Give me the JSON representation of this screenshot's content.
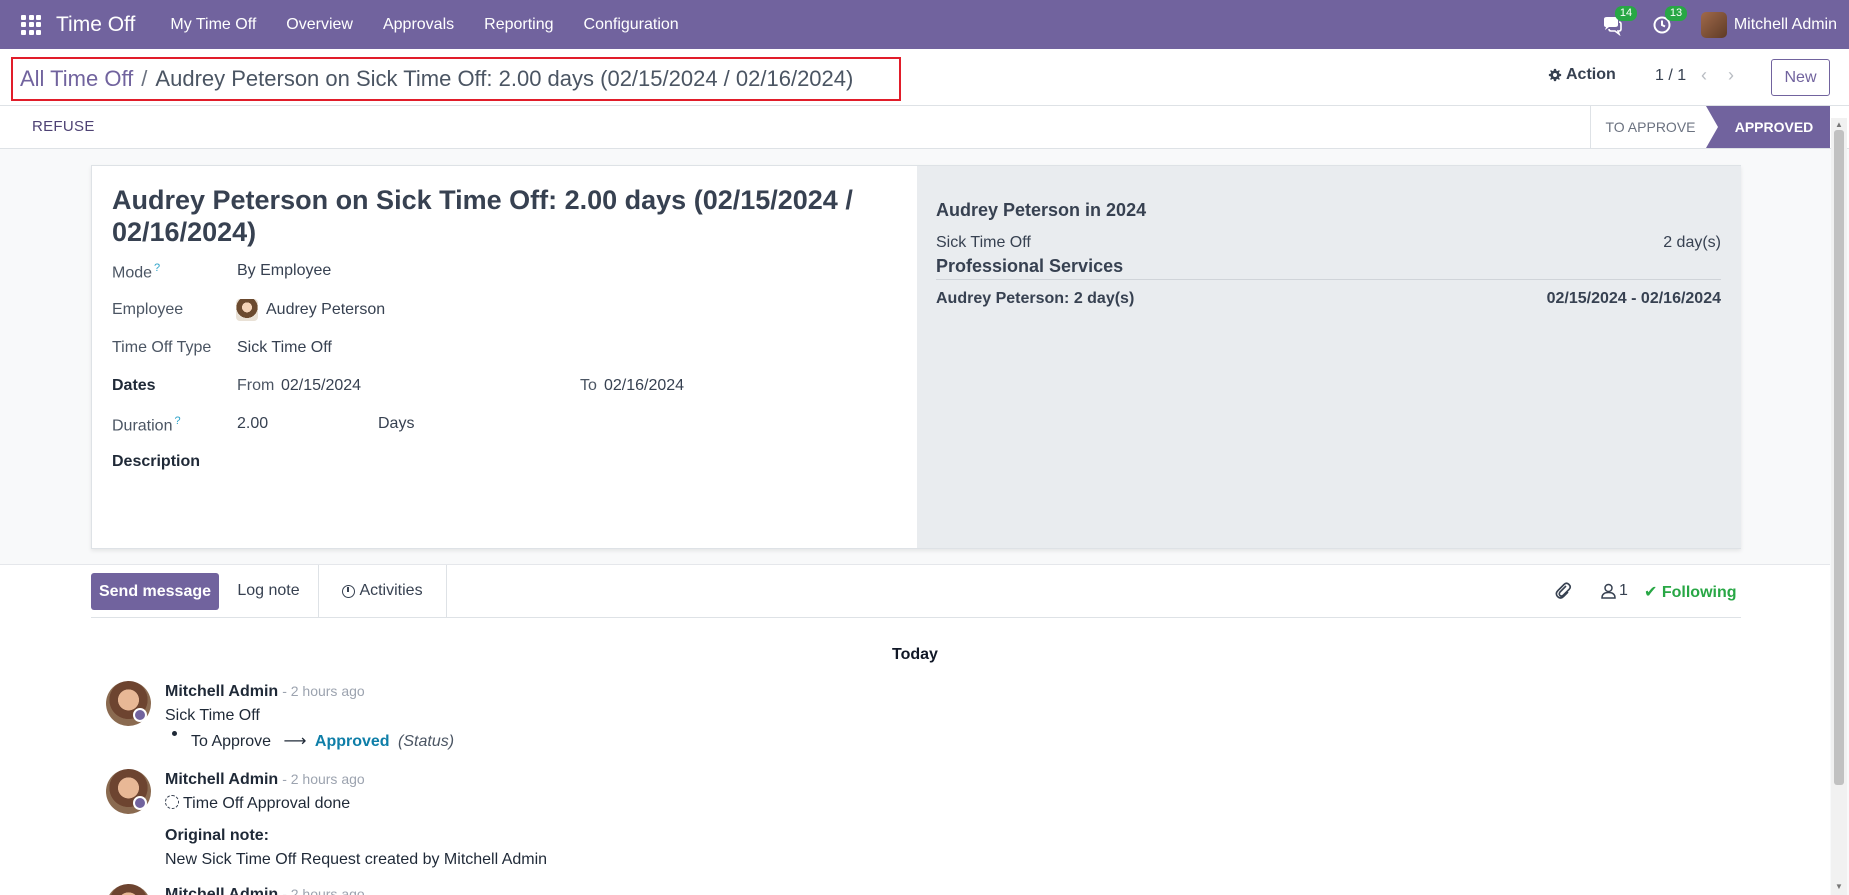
{
  "navbar": {
    "app_name": "Time Off",
    "menu": [
      "My Time Off",
      "Overview",
      "Approvals",
      "Reporting",
      "Configuration"
    ],
    "messages_count": "14",
    "activities_count": "13",
    "user_name": "Mitchell Admin",
    "accent_color": "#71639e"
  },
  "breadcrumb": {
    "parent": "All Time Off",
    "separator": "/",
    "current": "Audrey Peterson on Sick Time Off: 2.00 days (02/15/2024 / 02/16/2024)"
  },
  "control": {
    "action_label": "Action",
    "pager": "1 / 1",
    "new_label": "New"
  },
  "statusbar": {
    "refuse_label": "REFUSE",
    "stages": [
      "TO APPROVE",
      "APPROVED"
    ],
    "active_stage": "APPROVED"
  },
  "form": {
    "title": "Audrey Peterson on Sick Time Off: 2.00 days (02/15/2024 / 02/16/2024)",
    "mode_label": "Mode",
    "mode_value": "By Employee",
    "employee_label": "Employee",
    "employee_value": "Audrey Peterson",
    "type_label": "Time Off Type",
    "type_value": "Sick Time Off",
    "dates_label": "Dates",
    "from_label": "From",
    "from_value": "02/15/2024",
    "to_label": "To",
    "to_value": "02/16/2024",
    "duration_label": "Duration",
    "duration_value": "2.00",
    "duration_unit": "Days",
    "description_label": "Description",
    "help_mark": "?"
  },
  "summary": {
    "title": "Audrey Peterson in 2024",
    "row1_label": "Sick Time Off",
    "row1_value": "2 day(s)",
    "department": "Professional Services",
    "row2_label": "Audrey Peterson: 2 day(s)",
    "row2_value": "02/15/2024 - 02/16/2024"
  },
  "chatter": {
    "send_message": "Send message",
    "log_note": "Log note",
    "activities": "Activities",
    "followers_count": "1",
    "following_label": "Following",
    "date_separator": "Today",
    "messages": [
      {
        "author": "Mitchell Admin",
        "time": "- 2 hours ago",
        "body": "Sick Time Off",
        "change_from": "To Approve",
        "arrow": "⟶",
        "change_to": "Approved",
        "change_field": "(Status)"
      },
      {
        "author": "Mitchell Admin",
        "time": "- 2 hours ago",
        "body": "Time Off Approval done",
        "note_label": "Original note:",
        "note_text": "New Sick Time Off Request created by Mitchell Admin"
      },
      {
        "author": "Mitchell Admin",
        "time": "- 2 hours ago"
      }
    ]
  }
}
